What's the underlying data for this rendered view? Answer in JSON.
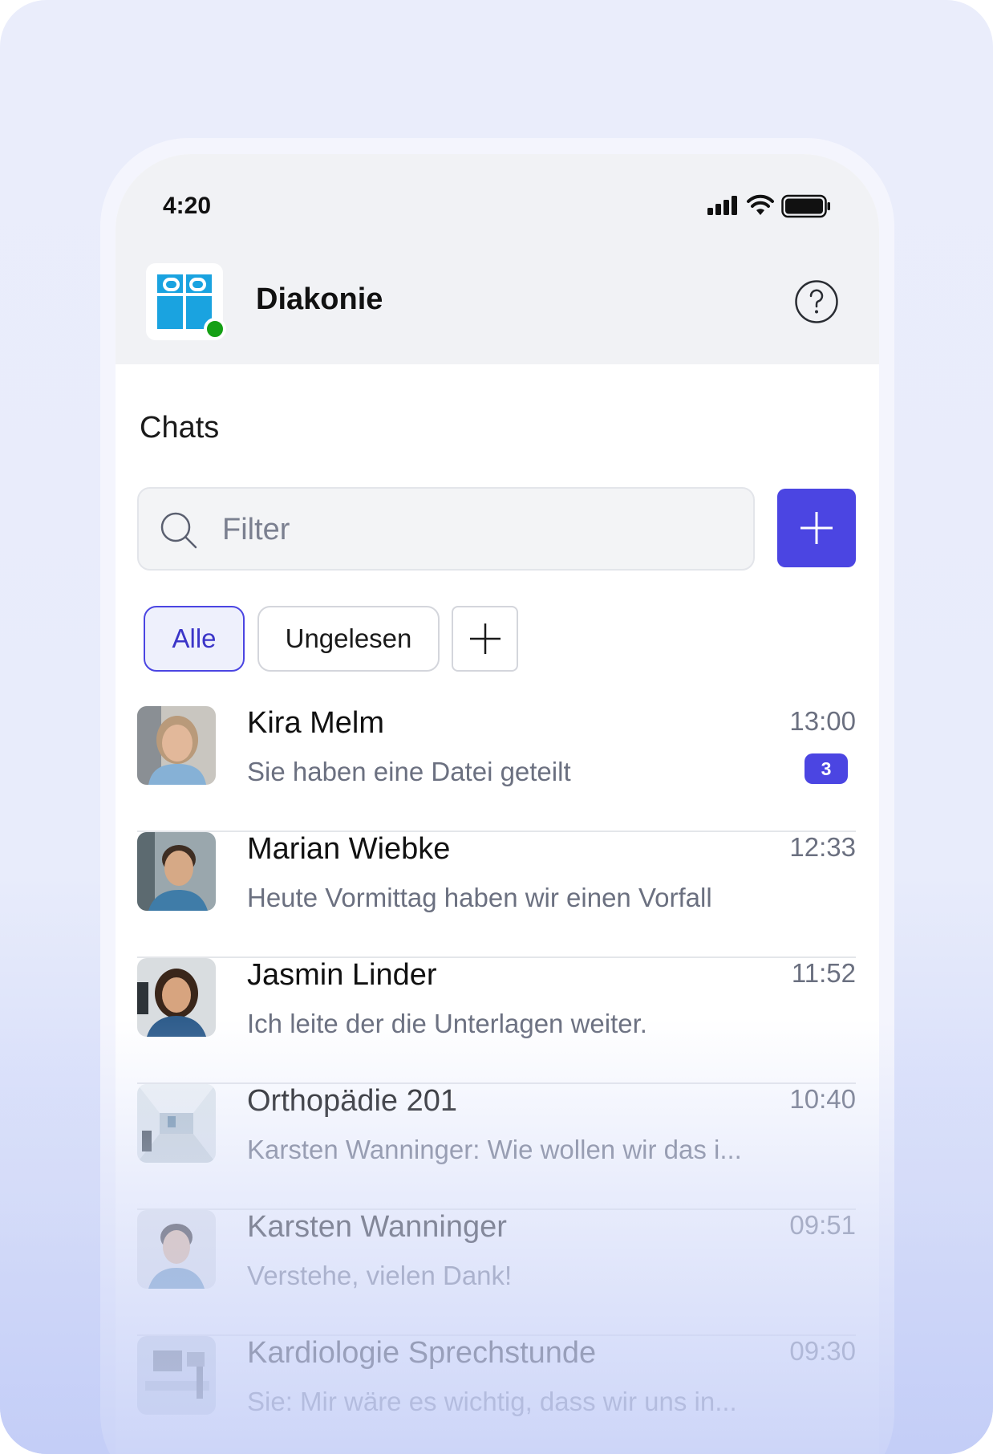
{
  "status_bar": {
    "time": "4:20",
    "signal_icon": "cellular-signal-icon",
    "wifi_icon": "wifi-icon",
    "battery_icon": "battery-icon"
  },
  "header": {
    "brand": "Diakonie",
    "logo_icon": "diakonie-logo-icon",
    "help_icon": "help-icon"
  },
  "colors": {
    "accent": "#4b45e2",
    "online": "#15a015",
    "logo_blue": "#1aa3e0"
  },
  "chats": {
    "title": "Chats",
    "search": {
      "placeholder": "Filter"
    },
    "filters": [
      {
        "label": "Alle",
        "active": true
      },
      {
        "label": "Ungelesen",
        "active": false
      }
    ],
    "items": [
      {
        "name": "Kira Melm",
        "preview": "Sie haben eine Datei geteilt",
        "time": "13:00",
        "unread": "3"
      },
      {
        "name": "Marian Wiebke",
        "preview": "Heute Vormittag haben wir einen Vorfall",
        "time": "12:33"
      },
      {
        "name": "Jasmin Linder",
        "preview": "Ich leite der die Unterlagen weiter.",
        "time": "11:52"
      },
      {
        "name": "Orthopädie 201",
        "preview": "Karsten Wanninger: Wie wollen wir das i...",
        "time": "10:40"
      },
      {
        "name": "Karsten Wanninger",
        "preview": "Verstehe, vielen Dank!",
        "time": "09:51"
      },
      {
        "name": "Kardiologie Sprechstunde",
        "preview": "Sie: Mir wäre es wichtig, dass wir uns in...",
        "time": "09:30"
      }
    ]
  }
}
